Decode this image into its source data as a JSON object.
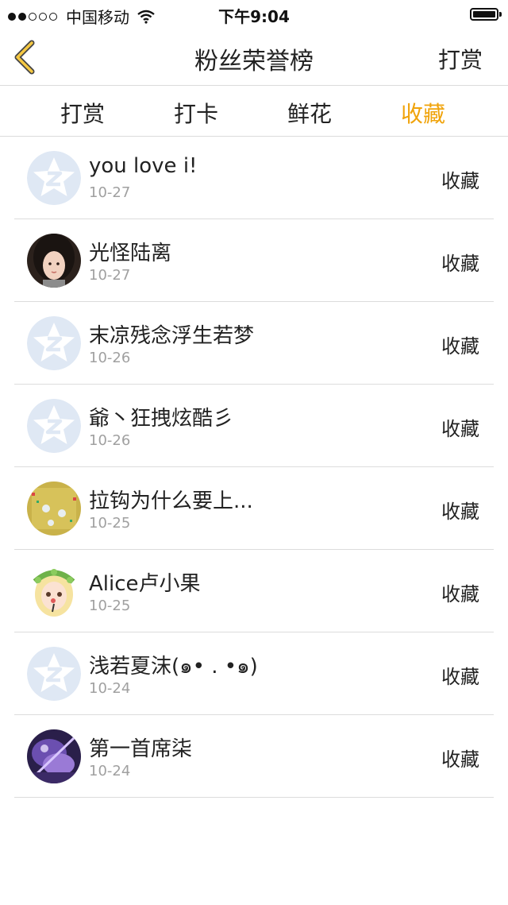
{
  "status_bar": {
    "carrier": "中国移动",
    "time": "下午9:04",
    "signal_dots_filled": 2,
    "signal_dots_total": 5,
    "battery_level": 1.0
  },
  "nav": {
    "title": "粉丝荣誉榜",
    "right_label": "打赏",
    "back_icon": "chevron-left-icon",
    "back_color": "#f0a30a"
  },
  "tabs": [
    {
      "label": "打赏",
      "active": false
    },
    {
      "label": "打卡",
      "active": false
    },
    {
      "label": "鲜花",
      "active": false
    },
    {
      "label": "收藏",
      "active": true
    }
  ],
  "accent_color": "#f0a30a",
  "list": [
    {
      "name": "you love i!",
      "date": "10-27",
      "action": "收藏",
      "avatar": "default-qzone-avatar"
    },
    {
      "name": "光怪陆离",
      "date": "10-27",
      "action": "收藏",
      "avatar": "girl-photo-avatar"
    },
    {
      "name": "末凉残念浮生若梦",
      "date": "10-26",
      "action": "收藏",
      "avatar": "default-qzone-avatar"
    },
    {
      "name": "爺丶狂拽炫酷彡",
      "date": "10-26",
      "action": "收藏",
      "avatar": "default-qzone-avatar"
    },
    {
      "name": "拉钩为什么要上...",
      "date": "10-25",
      "action": "收藏",
      "avatar": "game-field-avatar"
    },
    {
      "name": "Alice卢小果",
      "date": "10-25",
      "action": "收藏",
      "avatar": "cartoon-girl-avatar"
    },
    {
      "name": "浅若夏沫(๑• . •๑)",
      "date": "10-24",
      "action": "收藏",
      "avatar": "default-qzone-avatar"
    },
    {
      "name": "第一首席柒",
      "date": "10-24",
      "action": "收藏",
      "avatar": "purple-art-avatar"
    }
  ]
}
